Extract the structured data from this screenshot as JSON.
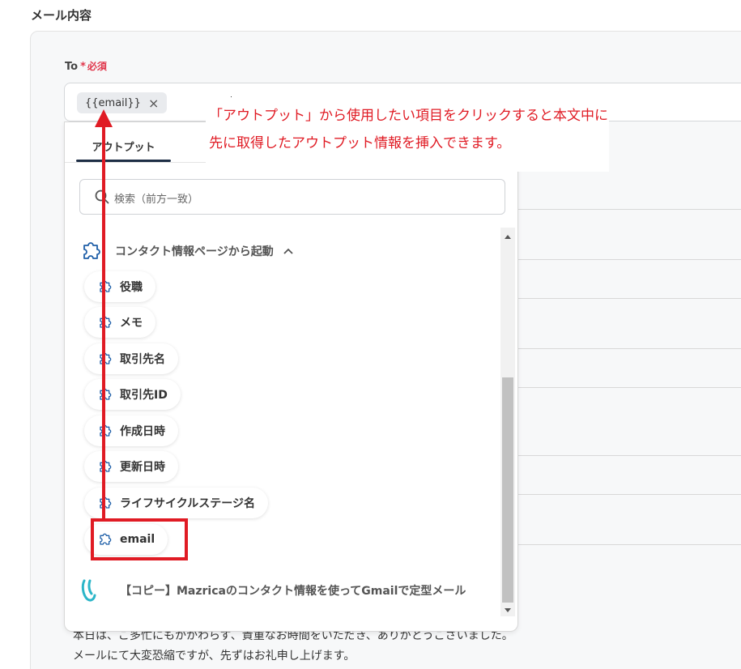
{
  "section_title": "メール内容",
  "to_field": {
    "label": "To",
    "required_mark": "*",
    "required_label": "必須",
    "chip_value": "{{email}}",
    "chip_remove": "×"
  },
  "dropdown": {
    "tab_label": "アウトプット",
    "search_placeholder": "検索（前方一致）",
    "group_label": "コンタクト情報ページから起動",
    "items": [
      {
        "label": "役職"
      },
      {
        "label": "メモ"
      },
      {
        "label": "取引先名"
      },
      {
        "label": "取引先ID"
      },
      {
        "label": "作成日時"
      },
      {
        "label": "更新日時"
      },
      {
        "label": "ライフサイクルステージ名"
      },
      {
        "label": "email"
      }
    ],
    "flow_label": "【コピー】Mazricaのコンタクト情報を使ってGmailで定型メール"
  },
  "callout": {
    "line1": "「アウトプット」から使用したい項目をクリックすると本文中に",
    "line2": "先に取得したアウトプット情報を挿入できます。"
  },
  "body_text": {
    "line1": "本日は、ご多忙にもかかわらず、貴重なお時間をいただき、ありがとうございました。",
    "line2": "メールにて大変恐縮ですが、先ずはお礼申し上げます。"
  },
  "colors": {
    "annotation_red": "#e01b24",
    "required_red": "#e0364b",
    "tab_underline": "#1d2e45",
    "flow_icon": "#2bb5c8"
  }
}
